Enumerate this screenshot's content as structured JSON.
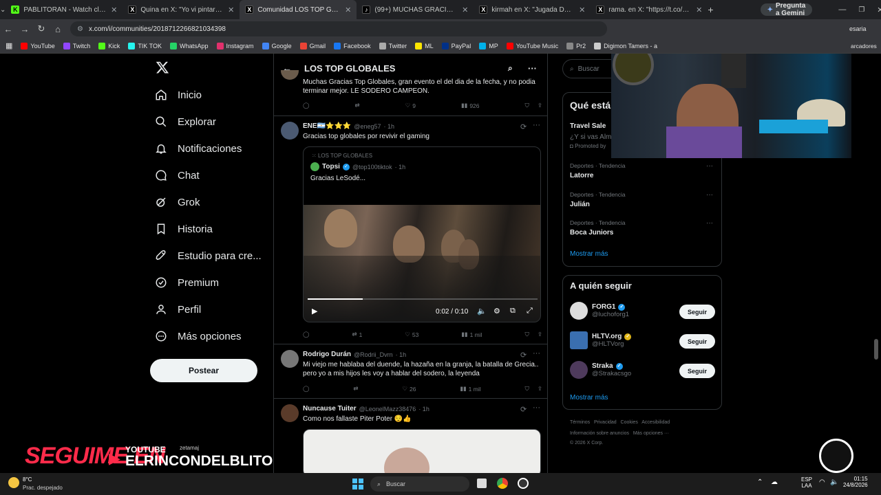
{
  "browser": {
    "tabs": [
      {
        "label": "PABLITORAN - Watch clips on K",
        "icon_color": "#53fc18",
        "icon": "K"
      },
      {
        "label": "Quina en X: \"Yo vi pintar a LESo",
        "icon_color": "#000000",
        "icon": "X"
      },
      {
        "label": "Comunidad LOS TOP GLOBALES",
        "icon_color": "#000000",
        "icon": "X"
      },
      {
        "label": "(99+) MUCHAS GRACIAS SODER",
        "icon_color": "#000000",
        "icon": "♪"
      },
      {
        "label": "kirmah en X: \"Jugada Del Major",
        "icon_color": "#000000",
        "icon": "X"
      },
      {
        "label": "rama. en X: \"https://t.co/16lob",
        "icon_color": "#000000",
        "icon": "X"
      }
    ],
    "new_tab": "+",
    "gemini": "Pregunta a Gemini",
    "url": "x.com/i/communities/2018712266821034398",
    "bookmarks": [
      {
        "label": "YouTube",
        "color": "#ff0000"
      },
      {
        "label": "Twitch",
        "color": "#9146ff"
      },
      {
        "label": "Kick",
        "color": "#53fc18"
      },
      {
        "label": "TIK TOK",
        "color": "#25f4ee"
      },
      {
        "label": "WhatsApp",
        "color": "#25d366"
      },
      {
        "label": "Instagram",
        "color": "#e1306c"
      },
      {
        "label": "Google",
        "color": "#4285f4"
      },
      {
        "label": "Gmail",
        "color": "#ea4335"
      },
      {
        "label": "Facebook",
        "color": "#1877f2"
      },
      {
        "label": "Twitter",
        "color": "#aaaaaa"
      },
      {
        "label": "ML",
        "color": "#ffe600"
      },
      {
        "label": "PayPal",
        "color": "#003087"
      },
      {
        "label": "MP",
        "color": "#00b1ea"
      },
      {
        "label": "YouTube Music",
        "color": "#ff0000"
      },
      {
        "label": "Pr2",
        "color": "#888888"
      },
      {
        "label": "Digimon Tamers - a",
        "color": "#cccccc"
      }
    ]
  },
  "nav": {
    "items": [
      "Inicio",
      "Explorar",
      "Notificaciones",
      "Chat",
      "Grok",
      "Historia",
      "Estudio para cre...",
      "Premium",
      "Perfil",
      "Más opciones"
    ],
    "post_label": "Postear"
  },
  "feed": {
    "title": "LOS TOP GLOBALES",
    "tweet0": {
      "text": "Muchas Gracias Top Globales, gran evento el del dia de la fecha, y no podia terminar mejor. LE SODERO CAMPEON.",
      "replies": "",
      "retweets": "",
      "likes": "9",
      "views": "926"
    },
    "tweet1": {
      "name": "ENE🇦🇷⭐⭐⭐",
      "handle": "@eneg57",
      "time": "· 1h",
      "text": "Gracias top globales por revivir el gaming",
      "quote_community": "LOS TOP GLOBALES",
      "quote_name": "Topsi",
      "quote_handle": "@top100tiktok",
      "quote_time": "· 1h",
      "quote_text": "Gracias LeSodé...",
      "video_time": "0:02 / 0:10",
      "replies": "",
      "retweets": "1",
      "likes": "53",
      "views": "1 mil"
    },
    "tweet2": {
      "name": "Rodrigo Durán",
      "handle": "@Rodrii_Dvrn",
      "time": "· 1h",
      "text": "Mi viejo me hablaba del duende, la hazaña en la granja, la batalla de Grecia.. pero yo a mis hijos les voy a hablar del sodero, la leyenda",
      "replies": "",
      "retweets": "",
      "likes": "26",
      "views": "1 mil"
    },
    "tweet3": {
      "name": "Nuncause Tuiter",
      "handle": "@LeonelMazz38476",
      "time": "· 1h",
      "text": "Como nos fallaste Piter Poter 😌👍"
    }
  },
  "right": {
    "search_placeholder": "Buscar",
    "trends_title": "Qué está",
    "promo_title": "Travel Sale",
    "promo_sub": "¿Y si vas Alm",
    "promo_label": "Promoted by",
    "trends": [
      {
        "category": "Deportes · Tendencia",
        "name": "Latorre"
      },
      {
        "category": "Deportes · Tendencia",
        "name": "Julián"
      },
      {
        "category": "Deportes · Tendencia",
        "name": "Boca Juniors"
      }
    ],
    "show_more": "Mostrar más",
    "follow_title": "A quién seguir",
    "follow": [
      {
        "name": "FORG1",
        "handle": "@luchoforg1",
        "badge": "blue"
      },
      {
        "name": "HLTV.org",
        "handle": "@HLTVorg",
        "badge": "gold"
      },
      {
        "name": "Straka",
        "handle": "@Strakacsgo",
        "badge": "blue"
      }
    ],
    "follow_btn": "Seguir",
    "follow_more": "Mostrar más",
    "footer_line1": "Términos   Privacidad   Cookies   Accesibilidad",
    "footer_line2": "Información sobre anuncios   Más opciones ···",
    "footer_line3": "© 2026 X Corp."
  },
  "overlay": {
    "seguime": "SEGUIME EN",
    "youtube": "YOUTUBE",
    "channel": "ELRINCONDELBLITO",
    "user": "zetamaj"
  },
  "taskbar": {
    "weather_temp": "8°C",
    "weather_desc": "Prac. despejado",
    "search": "Buscar",
    "lang1": "ESP",
    "lang2": "LAA",
    "time": "01:15",
    "date": "24/8/2026",
    "cut_text_right1": "esaria",
    "cut_text_right2": "arcadores"
  }
}
